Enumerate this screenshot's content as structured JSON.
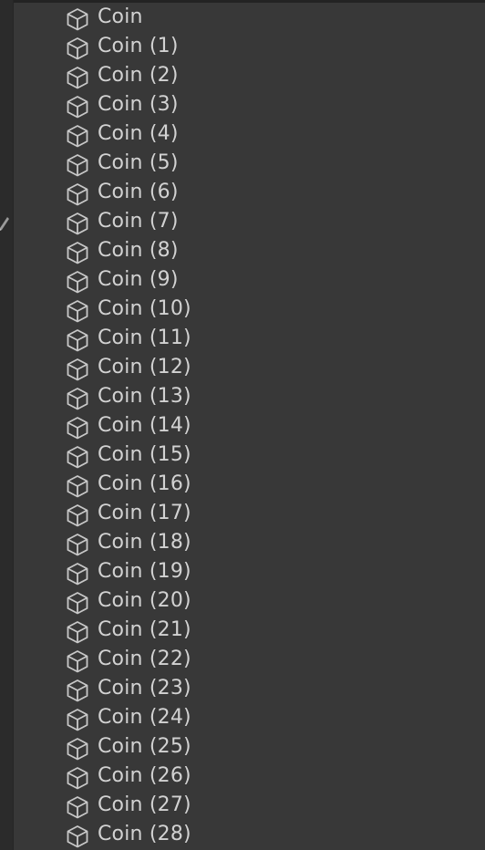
{
  "hierarchy": {
    "items": [
      {
        "label": "Coin"
      },
      {
        "label": "Coin (1)"
      },
      {
        "label": "Coin (2)"
      },
      {
        "label": "Coin (3)"
      },
      {
        "label": "Coin (4)"
      },
      {
        "label": "Coin (5)"
      },
      {
        "label": "Coin (6)"
      },
      {
        "label": "Coin (7)"
      },
      {
        "label": "Coin (8)"
      },
      {
        "label": "Coin (9)"
      },
      {
        "label": "Coin (10)"
      },
      {
        "label": "Coin (11)"
      },
      {
        "label": "Coin (12)"
      },
      {
        "label": "Coin (13)"
      },
      {
        "label": "Coin (14)"
      },
      {
        "label": "Coin (15)"
      },
      {
        "label": "Coin (16)"
      },
      {
        "label": "Coin (17)"
      },
      {
        "label": "Coin (18)"
      },
      {
        "label": "Coin (19)"
      },
      {
        "label": "Coin (20)"
      },
      {
        "label": "Coin (21)"
      },
      {
        "label": "Coin (22)"
      },
      {
        "label": "Coin (23)"
      },
      {
        "label": "Coin (24)"
      },
      {
        "label": "Coin (25)"
      },
      {
        "label": "Coin (26)"
      },
      {
        "label": "Coin (27)"
      },
      {
        "label": "Coin (28)"
      }
    ],
    "item_icon": "gameobject-cube-icon"
  },
  "colors": {
    "background": "#383838",
    "text": "#d2d2d2",
    "icon": "#c8c8c8",
    "gutter": "#2b2b2b"
  }
}
